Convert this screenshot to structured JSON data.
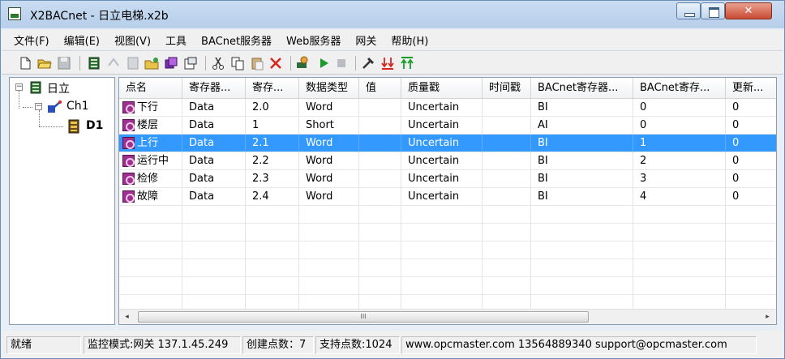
{
  "window": {
    "title": "X2BACnet - 日立电梯.x2b",
    "close_glyph": "✕"
  },
  "menu": [
    "文件(F)",
    "编辑(E)",
    "视图(V)",
    "工具",
    "BACnet服务器",
    "Web服务器",
    "网关",
    "帮助(H)"
  ],
  "tree": {
    "root": "日立",
    "channel": "Ch1",
    "device": "D1"
  },
  "grid": {
    "columns": [
      "点名",
      "寄存器...",
      "寄存...",
      "数据类型",
      "值",
      "质量戳",
      "时间戳",
      "BACnet寄存器...",
      "BACnet寄存...",
      "更新..."
    ],
    "rows": [
      [
        "下行",
        "Data",
        "2.0",
        "Word",
        "",
        "Uncertain",
        "",
        "BI",
        "0",
        "0"
      ],
      [
        "楼层",
        "Data",
        "1",
        "Short",
        "",
        "Uncertain",
        "",
        "AI",
        "0",
        "0"
      ],
      [
        "上行",
        "Data",
        "2.1",
        "Word",
        "",
        "Uncertain",
        "",
        "BI",
        "1",
        "0"
      ],
      [
        "运行中",
        "Data",
        "2.2",
        "Word",
        "",
        "Uncertain",
        "",
        "BI",
        "2",
        "0"
      ],
      [
        "检修",
        "Data",
        "2.3",
        "Word",
        "",
        "Uncertain",
        "",
        "BI",
        "3",
        "0"
      ],
      [
        "故障",
        "Data",
        "2.4",
        "Word",
        "",
        "Uncertain",
        "",
        "BI",
        "4",
        "0"
      ]
    ],
    "selected_row": 2,
    "scroll_thumb_grip": "III"
  },
  "status": {
    "ready": "就绪",
    "mode": "监控模式:网关 137.1.45.249",
    "created": "创建点数：7",
    "supported": "支持点数:1024",
    "contact": "www.opcmaster.com 13564889340 support@opcmaster.com"
  },
  "colors": {
    "selection": "#3399ff",
    "point_icon": "#9d2f8e",
    "run_green": "#1a9c2a",
    "delete_red": "#d8261c"
  }
}
